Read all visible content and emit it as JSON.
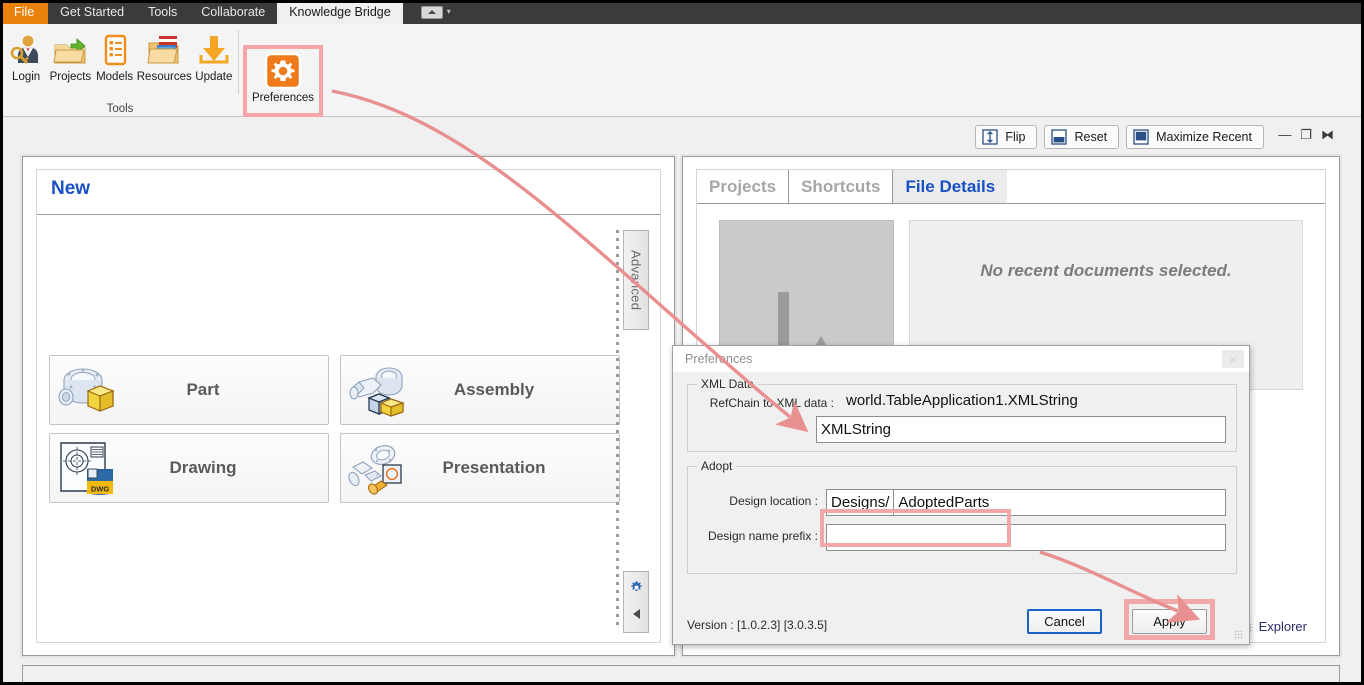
{
  "ribbon": {
    "tabs": [
      {
        "label": "File",
        "kind": "file"
      },
      {
        "label": "Get Started",
        "kind": "normal"
      },
      {
        "label": "Tools",
        "kind": "normal"
      },
      {
        "label": "Collaborate",
        "kind": "normal"
      },
      {
        "label": "Knowledge Bridge",
        "kind": "active"
      }
    ],
    "collapse_caret": "▾",
    "group_title": "Tools",
    "items": [
      {
        "label": "Login",
        "icon": "user-key-icon"
      },
      {
        "label": "Projects",
        "icon": "folder-arrow-icon"
      },
      {
        "label": "Models",
        "icon": "list-document-icon"
      },
      {
        "label": "Resources",
        "icon": "folder-files-icon"
      },
      {
        "label": "Update",
        "icon": "download-arrow-icon"
      }
    ],
    "preferences": {
      "label": "Preferences",
      "icon": "gear-icon",
      "highlight_color": "#f5a6a6"
    }
  },
  "workspace": {
    "buttons": [
      {
        "label": "Flip",
        "icon": "flip-icon"
      },
      {
        "label": "Reset",
        "icon": "reset-icon"
      },
      {
        "label": "Maximize Recent",
        "icon": "maximize-icon"
      }
    ],
    "window_controls": [
      {
        "name": "minimize",
        "glyph": "—"
      },
      {
        "name": "restore",
        "glyph": "❐"
      },
      {
        "name": "close",
        "glyph": "⧓"
      }
    ]
  },
  "new_panel": {
    "title": "New",
    "documents": [
      {
        "label": "Part",
        "icon": "part-icon"
      },
      {
        "label": "Assembly",
        "icon": "assembly-icon"
      },
      {
        "label": "Drawing",
        "icon": "drawing-dwg-icon"
      },
      {
        "label": "Presentation",
        "icon": "presentation-icon"
      }
    ],
    "advanced_tab": "Advanced",
    "settings_icon": "gear-icon",
    "collapse_icon": "triangle-left-icon"
  },
  "recent_panel": {
    "tabs": [
      {
        "label": "Projects",
        "active": false
      },
      {
        "label": "Shortcuts",
        "active": false
      },
      {
        "label": "File Details",
        "active": true
      }
    ],
    "thumbnail_icon": "image-placeholder-icon",
    "empty_message": "No recent documents selected.",
    "explorer_label": "Explorer"
  },
  "dialog": {
    "title": "Preferences",
    "close_glyph": "×",
    "xml_group": {
      "legend": "XML Data",
      "refchain_label": "RefChain to XML data :",
      "refchain_value": "world.TableApplication1.XMLString",
      "input_value": "XMLString"
    },
    "adopt_group": {
      "legend": "Adopt",
      "design_location_label": "Design location :",
      "design_location_prefix": "Designs/",
      "design_location_value": "AdoptedParts",
      "design_prefix_label": "Design name prefix :",
      "design_prefix_value": ""
    },
    "version": "Version : [1.0.2.3] [3.0.3.5]",
    "cancel_label": "Cancel",
    "apply_label": "Apply"
  },
  "annotation": {
    "color": "#e8908f",
    "highlight_color": "#f2a8a8"
  }
}
